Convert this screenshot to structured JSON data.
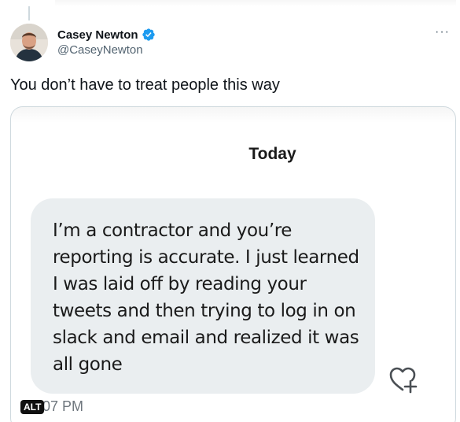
{
  "author": {
    "display_name": "Casey Newton",
    "handle": "@CaseyNewton",
    "verified": true
  },
  "menu": {
    "more_label": "···"
  },
  "tweet": {
    "text": "You don’t have to treat people this way"
  },
  "media": {
    "day_label": "Today",
    "message": "I’m a contractor and you’re reporting is accurate. I just learned I was laid off by reading your tweets and then trying to log in on slack and email and realized it was all gone",
    "time_partial": "07 PM",
    "alt_badge": "ALT"
  },
  "colors": {
    "accent": "#1d9bf0",
    "bubble": "#eaeef0",
    "text": "#0f1419",
    "muted": "#536471"
  }
}
